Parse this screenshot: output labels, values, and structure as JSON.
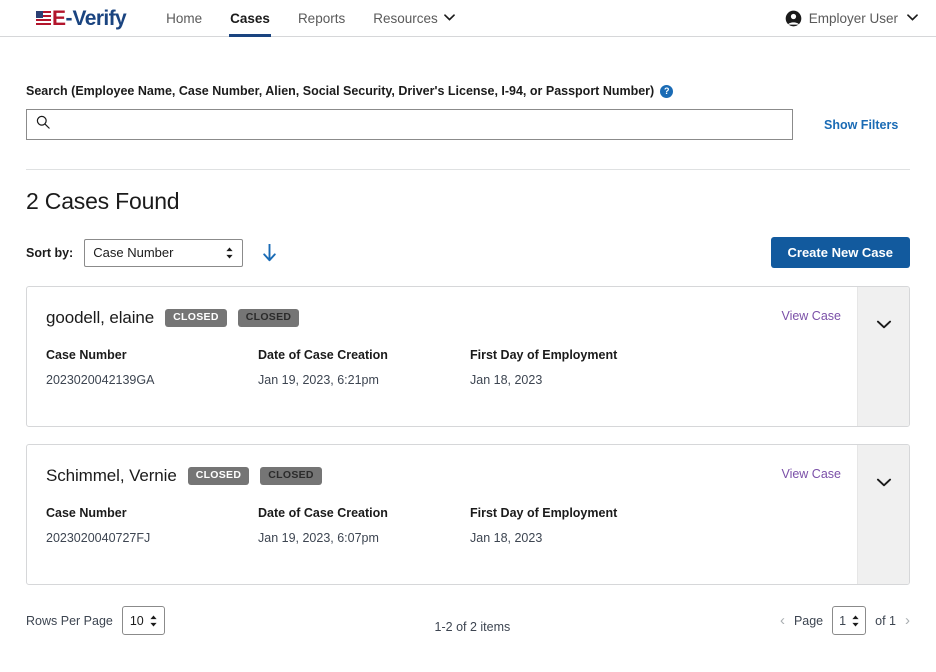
{
  "header": {
    "logo": {
      "e": "E",
      "dash": "-",
      "verify": "Verify",
      "alt": "E-Verify"
    },
    "nav": [
      {
        "label": "Home",
        "active": false
      },
      {
        "label": "Cases",
        "active": true
      },
      {
        "label": "Reports",
        "active": false
      },
      {
        "label": "Resources",
        "active": false,
        "caret": "⌄"
      }
    ],
    "user": {
      "name": "Employer User",
      "caret": "⌄"
    }
  },
  "search": {
    "label": "Search (Employee Name, Case Number, Alien, Social Security, Driver's License, I-94, or Passport Number)",
    "help_icon": "?",
    "value": "",
    "placeholder": "",
    "show_filters": "Show Filters"
  },
  "results": {
    "title": "2 Cases Found",
    "sort_label": "Sort by:",
    "sort_value": "Case Number",
    "sort_direction_icon": "arrow-down",
    "create_button": "Create New Case"
  },
  "cases": [
    {
      "name": "goodell, elaine",
      "badges": [
        {
          "text": "CLOSED",
          "style": "light"
        },
        {
          "text": "CLOSED",
          "style": "dark"
        }
      ],
      "view_link": "View Case",
      "fields": [
        {
          "label": "Case Number",
          "value": "2023020042139GA"
        },
        {
          "label": "Date of Case Creation",
          "value": "Jan 19, 2023, 6:21pm"
        },
        {
          "label": "First Day of Employment",
          "value": "Jan 18, 2023"
        }
      ]
    },
    {
      "name": "Schimmel, Vernie",
      "badges": [
        {
          "text": "CLOSED",
          "style": "light"
        },
        {
          "text": "CLOSED",
          "style": "dark"
        }
      ],
      "view_link": "View Case",
      "fields": [
        {
          "label": "Case Number",
          "value": "2023020040727FJ"
        },
        {
          "label": "Date of Case Creation",
          "value": "Jan 19, 2023, 6:07pm"
        },
        {
          "label": "First Day of Employment",
          "value": "Jan 18, 2023"
        }
      ]
    }
  ],
  "footer": {
    "rows_label": "Rows Per Page",
    "rows_value": "10",
    "item_count": "1-2 of 2 items",
    "page_label": "Page",
    "page_value": "1",
    "page_of": "of 1",
    "prev_icon": "‹",
    "next_icon": "›"
  },
  "colors": {
    "brand_blue": "#1a4480",
    "link_blue": "#1a6bb5",
    "button_blue": "#125a9e",
    "badge_gray": "#757575",
    "visited_link": "#7b50a8",
    "logo_red": "#b3152c"
  }
}
